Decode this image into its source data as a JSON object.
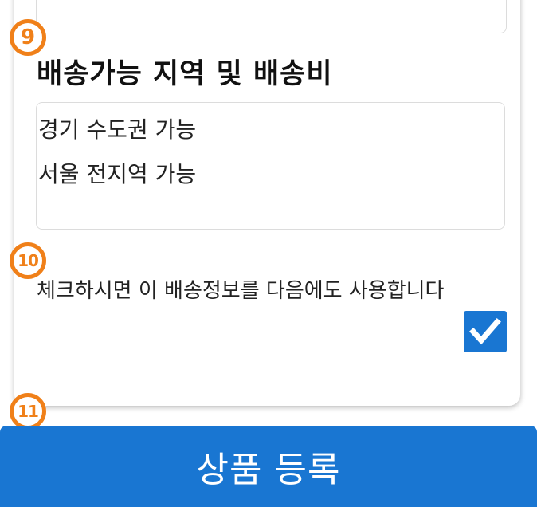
{
  "badges": {
    "step_9": "9",
    "step_10": "10",
    "step_11": "11"
  },
  "delivery": {
    "title": "배송가능 지역 및 배송비",
    "lines": [
      "경기 수도권 가능",
      "서울 전지역 가능"
    ]
  },
  "reuse": {
    "label": "체크하시면 이 배송정보를 다음에도 사용합니다",
    "checked": true
  },
  "submit": {
    "label": "상품 등록"
  },
  "colors": {
    "accent": "#1976d2",
    "badge": "#f08019"
  },
  "icons": {
    "checkbox": "checkmark-icon"
  }
}
